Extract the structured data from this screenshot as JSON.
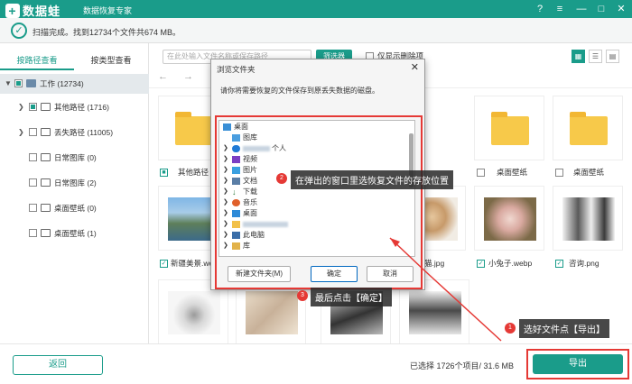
{
  "app": {
    "logo_text": "数据蛙",
    "subtitle": "数据恢复专家"
  },
  "status": {
    "text": "扫描完成。找到12734个文件共674 MB。"
  },
  "tabs": [
    {
      "label": "按路径查看"
    },
    {
      "label": "按类型查看"
    }
  ],
  "tree": {
    "root": {
      "label": "工作 (12734)"
    },
    "items": [
      {
        "label": "其他路径 (1716)"
      },
      {
        "label": "丢失路径 (11005)"
      },
      {
        "label": "日常图库 (0)"
      },
      {
        "label": "日常图库 (2)"
      },
      {
        "label": "桌面壁纸 (0)"
      },
      {
        "label": "桌面壁纸 (1)"
      }
    ]
  },
  "toolbar": {
    "search_placeholder": "在此处输入文件名称或保存路径",
    "filter_label": "筛选器",
    "only_deleted_label": "仅显示删除项"
  },
  "grid": {
    "row1": [
      {
        "caption": "其他路径"
      },
      {
        "caption": "桌面壁纸"
      },
      {
        "caption": "桌面壁纸"
      }
    ],
    "row2": [
      {
        "caption": "新疆美景.webp"
      },
      {
        "caption": "猫.jpg"
      },
      {
        "caption": "小兔子.webp"
      },
      {
        "caption": "咨询.png"
      }
    ]
  },
  "dialog": {
    "title": "浏览文件夹",
    "prompt": "请你将需要恢复的文件保存到原丢失数据的磁盘。",
    "tree": [
      {
        "label": "桌面"
      },
      {
        "label": "图库"
      },
      {
        "label": "个人"
      },
      {
        "label": "视频"
      },
      {
        "label": "图片"
      },
      {
        "label": "文档"
      },
      {
        "label": "下载"
      },
      {
        "label": "音乐"
      },
      {
        "label": "桌面"
      },
      {
        "label": ""
      },
      {
        "label": "此电脑"
      },
      {
        "label": "库"
      }
    ],
    "new_folder_label": "新建文件夹(M)",
    "ok_label": "确定",
    "cancel_label": "取消"
  },
  "annotations": {
    "step1": {
      "num": "1",
      "text": "选好文件点【导出】"
    },
    "step2": {
      "num": "2",
      "text": "在弹出的窗口里选恢复文件的存放位置"
    },
    "step3": {
      "num": "3",
      "text": "最后点击【确定】"
    }
  },
  "bottom": {
    "back_label": "返回",
    "selection_info": "已选择 1726个项目/ 31.6 MB",
    "export_label": "导出"
  },
  "colors": {
    "accent": "#1a9c8a",
    "highlight": "#e53935"
  }
}
